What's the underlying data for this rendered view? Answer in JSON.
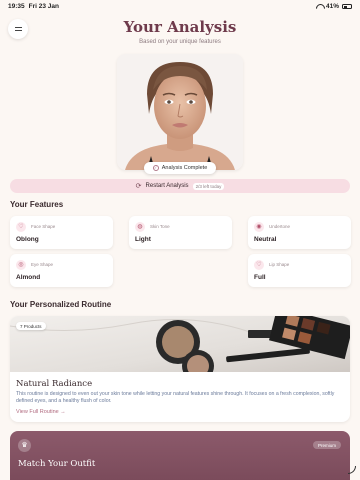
{
  "status_bar": {
    "time": "19:35",
    "date": "Fri 23 Jan",
    "battery": "41%"
  },
  "header": {
    "title": "Your Analysis",
    "subtitle": "Based on your unique features"
  },
  "photo": {
    "badge": "Analysis Complete"
  },
  "restart": {
    "label": "Restart Analysis",
    "count": "2/3 left today"
  },
  "features": {
    "title": "Your Features",
    "items": [
      {
        "label": "Face Shape",
        "value": "Oblong",
        "icon": "heart-icon"
      },
      {
        "label": "Skin Tone",
        "value": "Light",
        "icon": "palette-icon"
      },
      {
        "label": "Undertone",
        "value": "Neutral",
        "icon": "drop-icon"
      },
      {
        "label": "Eye Shape",
        "value": "Almond",
        "icon": "eye-icon"
      },
      {
        "label": "Lip Shape",
        "value": "Full",
        "icon": "heart-icon"
      }
    ]
  },
  "routine": {
    "title": "Your Personalized Routine",
    "badge": "7 Products",
    "name": "Natural Radiance",
    "description": "This routine is designed to even out your skin tone while letting your natural features shine through. It focuses on a fresh complexion, softly defined eyes, and a healthy flush of color.",
    "link": "View Full Routine →"
  },
  "outfit": {
    "title": "Match Your Outfit",
    "badge": "Premium",
    "icon": "crown-icon"
  },
  "colors": {
    "accent": "#6e3a4b",
    "restart_bg": "#f7dde3",
    "outfit_bg": "#7b4b5b"
  }
}
